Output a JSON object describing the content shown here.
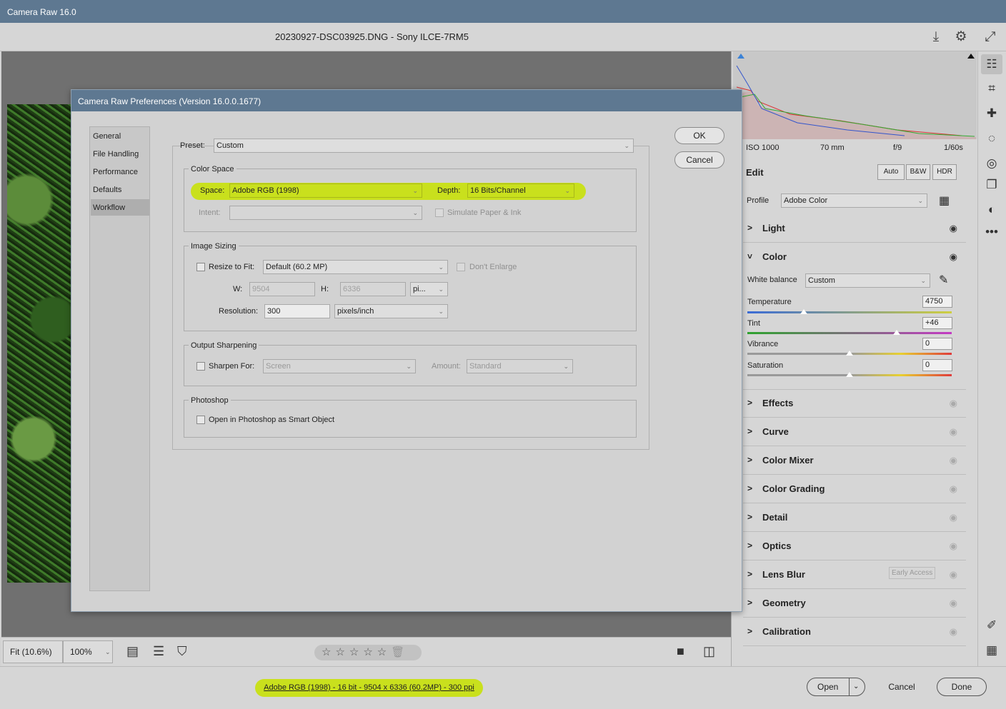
{
  "window": {
    "title": "Camera Raw 16.0"
  },
  "topbar": {
    "filename": "20230927-DSC03925.DNG  -  Sony ILCE-7RM5"
  },
  "viewbar": {
    "zoom_fit": "Fit (10.6%)",
    "zoom_100": "100%"
  },
  "footer": {
    "workflow_link": "Adobe RGB (1998) - 16 bit - 9504 x 6336 (60.2MP) - 300 ppi",
    "open_label": "Open",
    "cancel_label": "Cancel",
    "done_label": "Done"
  },
  "exif": {
    "iso": "ISO 1000",
    "focal": "70 mm",
    "aperture": "f/9",
    "shutter": "1/60s"
  },
  "edit": {
    "title": "Edit",
    "auto_label": "Auto",
    "bw_label": "B&W",
    "hdr_label": "HDR",
    "profile_label": "Profile",
    "profile_value": "Adobe Color"
  },
  "panels": {
    "light": "Light",
    "color": "Color",
    "effects": "Effects",
    "curve": "Curve",
    "color_mixer": "Color Mixer",
    "color_grading": "Color Grading",
    "detail": "Detail",
    "optics": "Optics",
    "lens_blur": "Lens Blur",
    "lens_blur_badge": "Early Access",
    "geometry": "Geometry",
    "calibration": "Calibration"
  },
  "color_panel": {
    "wb_label": "White balance",
    "wb_value": "Custom",
    "temperature_label": "Temperature",
    "temperature_value": "4750",
    "tint_label": "Tint",
    "tint_value": "+46",
    "vibrance_label": "Vibrance",
    "vibrance_value": "0",
    "saturation_label": "Saturation",
    "saturation_value": "0"
  },
  "dialog": {
    "title": "Camera Raw Preferences  (Version 16.0.0.1677)",
    "nav": [
      "General",
      "File Handling",
      "Performance",
      "Defaults",
      "Workflow"
    ],
    "ok_label": "OK",
    "cancel_label": "Cancel",
    "preset_label": "Preset:",
    "preset_value": "Custom",
    "color_space": {
      "legend": "Color Space",
      "space_label": "Space:",
      "space_value": "Adobe RGB (1998)",
      "depth_label": "Depth:",
      "depth_value": "16 Bits/Channel",
      "intent_label": "Intent:",
      "simulate_label": "Simulate Paper & Ink"
    },
    "image_sizing": {
      "legend": "Image Sizing",
      "resize_label": "Resize to Fit:",
      "resize_value": "Default  (60.2 MP)",
      "dont_enlarge_label": "Don't Enlarge",
      "w_label": "W:",
      "w_value": "9504",
      "h_label": "H:",
      "h_value": "6336",
      "unit_value": "pi...",
      "resolution_label": "Resolution:",
      "resolution_value": "300",
      "resolution_unit": "pixels/inch"
    },
    "output_sharpening": {
      "legend": "Output Sharpening",
      "sharpen_label": "Sharpen For:",
      "sharpen_value": "Screen",
      "amount_label": "Amount:",
      "amount_value": "Standard"
    },
    "photoshop": {
      "legend": "Photoshop",
      "smart_object_label": "Open in Photoshop as Smart Object"
    }
  },
  "colors": {
    "accent_highlight": "#c9e01d",
    "titlebar": "#5e7891"
  }
}
